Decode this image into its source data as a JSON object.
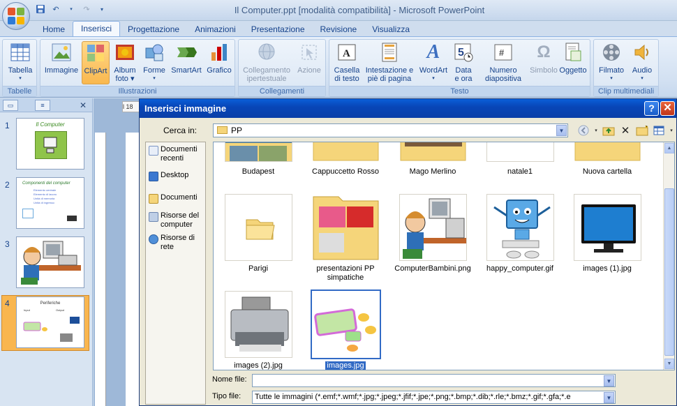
{
  "window": {
    "title": "Il Computer.ppt [modalità compatibilità] - Microsoft PowerPoint"
  },
  "tabs": [
    "Home",
    "Inserisci",
    "Progettazione",
    "Animazioni",
    "Presentazione",
    "Revisione",
    "Visualizza"
  ],
  "active_tab": "Inserisci",
  "ribbon": {
    "groups": {
      "tabelle": "Tabelle",
      "illustrazioni": "Illustrazioni",
      "collegamenti": "Collegamenti",
      "testo": "Testo",
      "clip": "Clip multimediali"
    },
    "buttons": {
      "tabella": "Tabella",
      "immagine": "Immagine",
      "clipart": "ClipArt",
      "album_1": "Album",
      "album_2": "foto",
      "forme": "Forme",
      "smartart": "SmartArt",
      "grafico": "Grafico",
      "collegamento_1": "Collegamento",
      "collegamento_2": "ipertestuale",
      "azione": "Azione",
      "casella_1": "Casella",
      "casella_2": "di testo",
      "intestazione_1": "Intestazione e",
      "intestazione_2": "piè di pagina",
      "wordart": "WordArt",
      "data_1": "Data",
      "data_2": "e ora",
      "numero_1": "Numero",
      "numero_2": "diapositiva",
      "simbolo": "Simbolo",
      "oggetto": "Oggetto",
      "filmato": "Filmato",
      "audio": "Audio"
    }
  },
  "slides": [
    {
      "num": "1",
      "title": "Il Computer"
    },
    {
      "num": "2",
      "title": "Componenti del computer",
      "bullets": [
        "Elemento centrale",
        "Elemento di lavoro",
        "Unità di memoria",
        "Unità di ingresso"
      ]
    },
    {
      "num": "3"
    },
    {
      "num": "4",
      "title": "Periferiche",
      "bullets": [
        "Input",
        "Output"
      ]
    }
  ],
  "ruler_h": "l 18",
  "dialog": {
    "title": "Inserisci immagine",
    "help": "?",
    "close": "✕",
    "lookin_label": "Cerca in:",
    "lookin_value": "PP",
    "places": [
      "Documenti recenti",
      "Desktop",
      "Documenti",
      "Risorse del computer",
      "Risorse di rete"
    ],
    "files": [
      {
        "name": "Budapest",
        "type": "folder"
      },
      {
        "name": "Cappuccetto Rosso",
        "type": "folder"
      },
      {
        "name": "Mago Merlino",
        "type": "folder"
      },
      {
        "name": "natale1",
        "type": "image"
      },
      {
        "name": "Nuova cartella",
        "type": "folder"
      },
      {
        "name": "Parigi",
        "type": "folder"
      },
      {
        "name": "presentazioni PP simpatiche",
        "type": "folder"
      },
      {
        "name": "ComputerBambini.png",
        "type": "image"
      },
      {
        "name": "happy_computer.gif",
        "type": "image"
      },
      {
        "name": "images (1).jpg",
        "type": "image"
      },
      {
        "name": "images (2).jpg",
        "type": "image"
      },
      {
        "name": "images.jpg",
        "type": "image",
        "selected": true
      }
    ],
    "filename_label": "Nome file:",
    "filename_value": "",
    "filetype_label": "Tipo file:",
    "filetype_value": "Tutte le immagini (*.emf;*.wmf;*.jpg;*.jpeg;*.jfif;*.jpe;*.png;*.bmp;*.dib;*.rle;*.bmz;*.gif;*.gfa;*.e"
  },
  "colors": {
    "accent": "#316ac5",
    "ribbon_text": "#15428b",
    "dialog_title": "#0a4fc8",
    "selected_button": "#f9b84f"
  }
}
